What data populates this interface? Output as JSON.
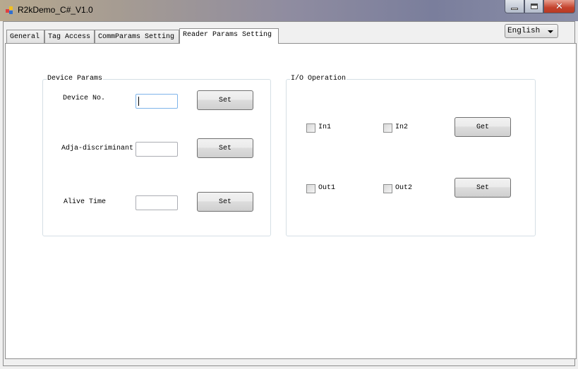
{
  "window": {
    "title": "R2kDemo_C#_V1.0",
    "minimize_icon": "minimize-icon",
    "maximize_icon": "maximize-icon",
    "close_icon": "close-icon"
  },
  "tabs": [
    {
      "label": "General"
    },
    {
      "label": "Tag Access"
    },
    {
      "label": "CommParams Setting"
    },
    {
      "label": "Reader Params Setting",
      "active": true
    }
  ],
  "language": {
    "selected": "English"
  },
  "device_params": {
    "title": "Device Params",
    "rows": [
      {
        "label": "Device No.",
        "value": "",
        "button": "Set"
      },
      {
        "label": "Adja-discriminant",
        "value": "",
        "button": "Set"
      },
      {
        "label": "Alive Time",
        "value": "",
        "button": "Set"
      }
    ]
  },
  "io_operation": {
    "title": "I/O Operation",
    "in1": {
      "label": "In1",
      "checked": false
    },
    "in2": {
      "label": "In2",
      "checked": false
    },
    "get_button": "Get",
    "out1": {
      "label": "Out1",
      "checked": false
    },
    "out2": {
      "label": "Out2",
      "checked": false
    },
    "set_button": "Set"
  }
}
